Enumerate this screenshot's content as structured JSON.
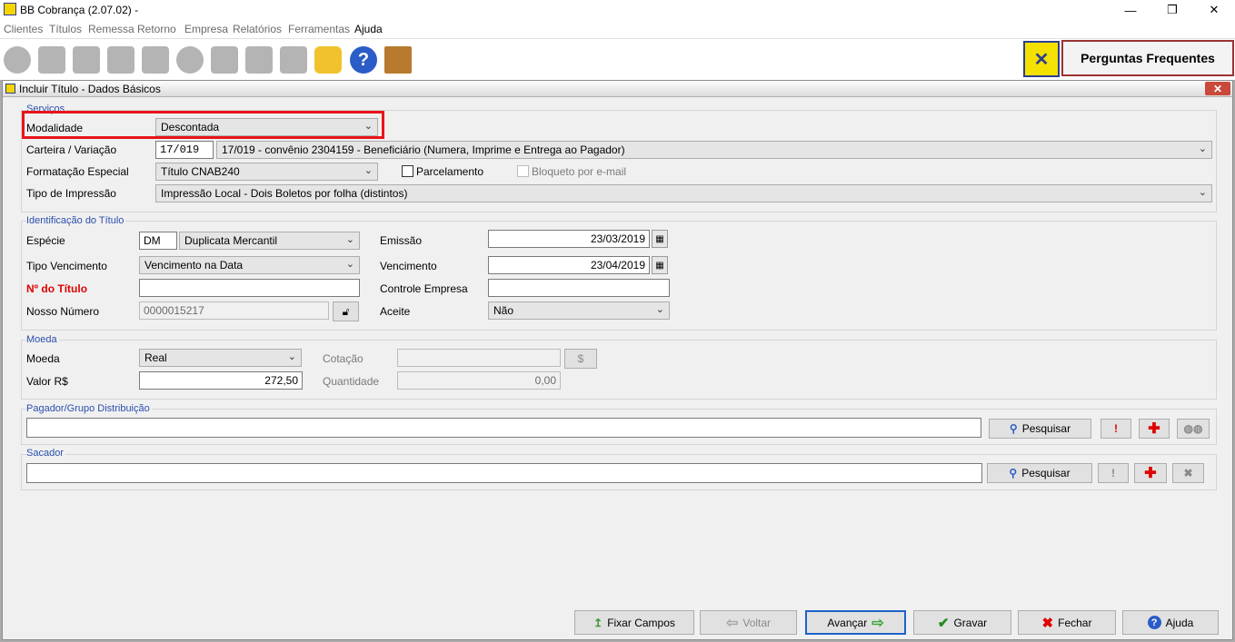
{
  "window": {
    "title": "BB Cobrança (2.07.02)  -",
    "minimize": "—",
    "maximize": "❐",
    "close": "✕"
  },
  "menu": [
    "Clientes",
    "Títulos",
    "Remessa",
    "Retorno",
    "Empresa",
    "Relatórios",
    "Ferramentas",
    "Ajuda"
  ],
  "toolbar": {
    "help_glyph": "?",
    "faq_label": "Perguntas Frequentes"
  },
  "child": {
    "title": "Incluir Título - Dados Básicos",
    "close": "✕"
  },
  "servicos": {
    "label": "Serviços",
    "modalidade_label": "Modalidade",
    "modalidade_value": "Descontada",
    "carteira_label": "Carteira / Variação",
    "carteira_code": "17/019",
    "carteira_desc": "17/019 - convênio 2304159 - Beneficiário (Numera, Imprime e Entrega ao Pagador)",
    "formatacao_label": "Formatação Especial",
    "formatacao_value": "Título CNAB240",
    "parcelamento_label": "Parcelamento",
    "bloqueto_label": "Bloqueto por e-mail",
    "impressao_label": "Tipo de Impressão",
    "impressao_value": "Impressão Local - Dois Boletos por folha (distintos)"
  },
  "identificacao": {
    "label": "Identificação do Título",
    "especie_label": "Espécie",
    "especie_code": "DM",
    "especie_value": "Duplicata Mercantil",
    "emissao_label": "Emissão",
    "emissao_value": "23/03/2019",
    "tipo_venc_label": "Tipo Vencimento",
    "tipo_venc_value": "Vencimento na Data",
    "vencimento_label": "Vencimento",
    "vencimento_value": "23/04/2019",
    "numero_label": "Nº do Título",
    "numero_value": "",
    "controle_label": "Controle Empresa",
    "controle_value": "",
    "nosso_label": "Nosso Número",
    "nosso_value": "0000015217",
    "aceite_label": "Aceite",
    "aceite_value": "Não"
  },
  "moeda": {
    "label": "Moeda",
    "moeda_label": "Moeda",
    "moeda_value": "Real",
    "cotacao_label": "Cotação",
    "cotacao_value": "",
    "valor_label": "Valor R$",
    "valor_value": "272,50",
    "quantidade_label": "Quantidade",
    "quantidade_value": "0,00"
  },
  "pagador": {
    "label": "Pagador/Grupo Distribuição",
    "value": "",
    "pesquisar": "Pesquisar"
  },
  "sacador": {
    "label": "Sacador",
    "value": "",
    "pesquisar": "Pesquisar"
  },
  "footer": {
    "fixar": "Fixar Campos",
    "voltar": "Voltar",
    "avancar": "Avançar",
    "gravar": "Gravar",
    "fechar": "Fechar",
    "ajuda": "Ajuda"
  },
  "colors": {
    "highlight": "#e8141c",
    "required_label": "#e00000",
    "group_label": "#2b4fae",
    "bb_yellow": "#f5e100",
    "bb_blue": "#2c3f8f"
  }
}
